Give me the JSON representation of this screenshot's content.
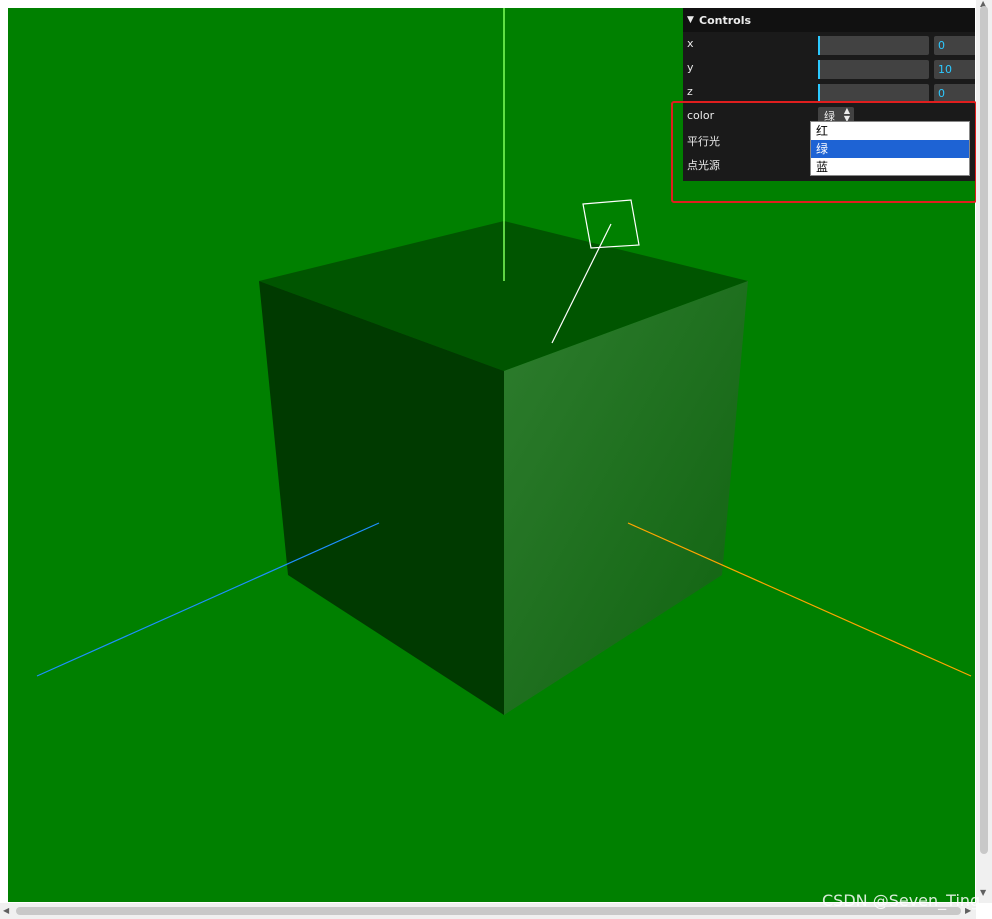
{
  "gui": {
    "title": "Controls",
    "x": {
      "label": "x",
      "value": "0"
    },
    "y": {
      "label": "y",
      "value": "10"
    },
    "z": {
      "label": "z",
      "value": "0"
    },
    "color": {
      "label": "color",
      "selected": "绿",
      "options": [
        "红",
        "绿",
        "蓝"
      ]
    },
    "directional_light": {
      "label": "平行光"
    },
    "point_light": {
      "label": "点光源"
    }
  },
  "scene": {
    "background_color": "#008000",
    "cube_top_color": "#005500",
    "cube_left_color": "#003a00",
    "cube_right_color": "#1a6e1a",
    "axis_y_color": "#7fff5a",
    "axis_x_color": "#ffa500",
    "axis_z_color": "#1e90ff",
    "light_helper_color": "#ffffff"
  },
  "watermark": "CSDN @Seven_Ting"
}
